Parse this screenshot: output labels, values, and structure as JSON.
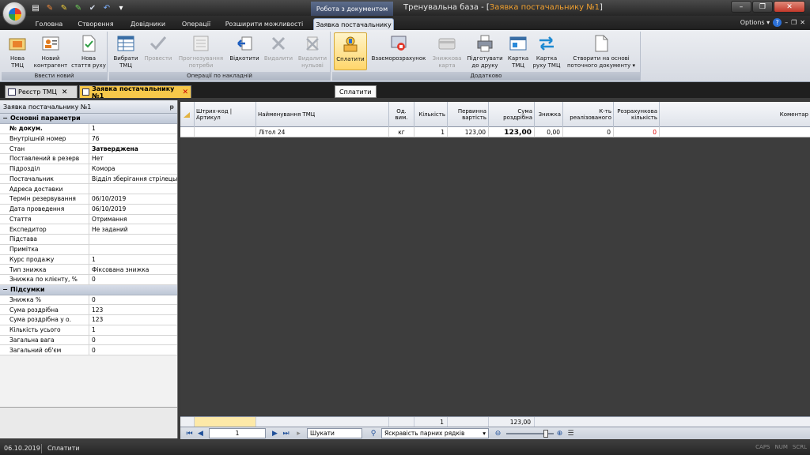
{
  "qat": [
    "▤",
    "✎",
    "✎",
    "✎",
    "✔",
    "↶",
    "▾"
  ],
  "ribbon_context": "Робота з документом",
  "window_title_prefix": "Тренувальна база - [",
  "window_title_doc": "Заявка постачальнику №1",
  "window_title_suffix": "]",
  "tabs": [
    "Головна",
    "Створення",
    "Довідники",
    "Операції",
    "Розширити можливості",
    "Заявка постачальнику"
  ],
  "options": "Options ▾",
  "ribbon_groups": {
    "g1": {
      "label": "Ввести новий",
      "buttons": [
        "Нова\nТМЦ",
        "Новий\nконтрагент",
        "Нова\nстаття руху"
      ]
    },
    "g2": {
      "label": "Операції по накладній",
      "buttons": [
        "Вибрати\nТМЦ",
        "Провести",
        "Прогнозування\nпотреби",
        "Відкотити",
        "Видалити",
        "Видалити\nнульові"
      ]
    },
    "g3": {
      "label": "Додатково",
      "buttons": [
        "Сплатити",
        "Взаєморозрахунок",
        "Знижкова\nкарта",
        "Підготувати\nдо друку",
        "Картка\nТМЦ",
        "Картка\nруху ТМЦ",
        "Створити на основі\nпоточного документу ▾"
      ]
    }
  },
  "doc_tabs": [
    "Реєстр ТМЦ",
    "Заявка постачальнику №1"
  ],
  "tooltip": "Сплатити",
  "left_panel": {
    "title": "Заявка постачальнику №1",
    "pin": "ᵽ",
    "section1": "Основні параметри",
    "props1": [
      {
        "k": "№ докум.",
        "v": "1",
        "bold": true
      },
      {
        "k": "Внутрішній номер",
        "v": "76"
      },
      {
        "k": "Стан",
        "v": "Затверджена",
        "vbold": true
      },
      {
        "k": "Поставлений в резерв",
        "v": "Нет"
      },
      {
        "k": "Підрозділ",
        "v": "Комора"
      },
      {
        "k": "Постачальник",
        "v": "Відділ зберігання стрілецьк"
      },
      {
        "k": "Адреса доставки",
        "v": ""
      },
      {
        "k": "Термін резервування",
        "v": "06/10/2019"
      },
      {
        "k": "Дата проведення",
        "v": "06/10/2019"
      },
      {
        "k": "Стаття",
        "v": "Отримання"
      },
      {
        "k": "Експедитор",
        "v": "Не заданий"
      },
      {
        "k": "Підстава",
        "v": ""
      },
      {
        "k": "Примітка",
        "v": ""
      },
      {
        "k": "Курс продажу",
        "v": "1"
      },
      {
        "k": "Тип знижка",
        "v": "Фіксована знижка"
      },
      {
        "k": "Знижка по клієнту, %",
        "v": "0"
      }
    ],
    "section2": "Підсумки",
    "props2": [
      {
        "k": "Знижка %",
        "v": "0"
      },
      {
        "k": "Сума роздрібна",
        "v": "123"
      },
      {
        "k": "Сума роздрібна у о.",
        "v": "123"
      },
      {
        "k": "Кількість усього",
        "v": "1"
      },
      {
        "k": "Загальна вага",
        "v": "0"
      },
      {
        "k": "Загальний об'єм",
        "v": "0"
      }
    ]
  },
  "grid": {
    "columns": [
      "Штрих-код |\nАртикул",
      "Найменування ТМЦ",
      "Од.\nвим.",
      "Кількість",
      "Первинна\nвартість",
      "Сума\nроздрібна",
      "Знижка",
      "К-ть\nреалізованого",
      "Розрахункова\nкількість",
      "Коментар"
    ],
    "row": [
      "",
      "Літол 24",
      "кг",
      "1",
      "123,00",
      "123,00",
      "0,00",
      "0",
      "0",
      ""
    ],
    "footer_qty": "1",
    "footer_sum": "123,00"
  },
  "navbar": {
    "page": "1",
    "search": "Шукати",
    "highlight": "Яскравість парних рядків"
  },
  "status": {
    "date": "06.10.2019",
    "text": "Сплатити",
    "keys": [
      "CAPS",
      "NUM",
      "SCRL"
    ]
  }
}
